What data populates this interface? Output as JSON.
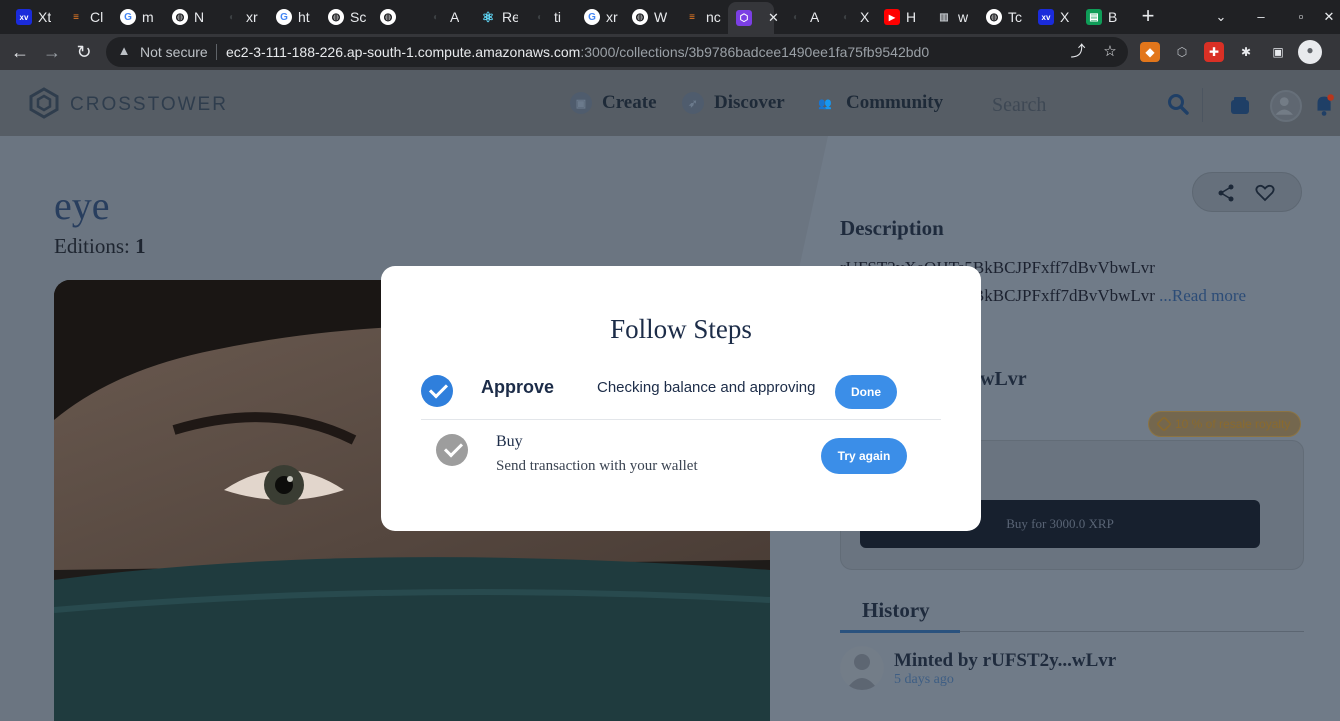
{
  "browser": {
    "tabs": [
      {
        "label": "Xt",
        "icon": "xaman-icon",
        "color": "#1a2bdb"
      },
      {
        "label": "Cl",
        "icon": "stackoverflow-icon",
        "color": "#f48024"
      },
      {
        "label": "m",
        "icon": "google-icon",
        "color": "#ffffff"
      },
      {
        "label": "N",
        "icon": "globe-icon",
        "color": "#ffffff"
      },
      {
        "label": "xr",
        "icon": "github-icon",
        "color": "#202124"
      },
      {
        "label": "ht",
        "icon": "google-icon",
        "color": "#ffffff"
      },
      {
        "label": "Sc",
        "icon": "globe-icon",
        "color": "#ffffff"
      },
      {
        "label": "",
        "icon": "globe-icon",
        "color": "#ffffff"
      },
      {
        "label": "A",
        "icon": "github-icon",
        "color": "#202124"
      },
      {
        "label": "Re",
        "icon": "react-icon",
        "color": "#61dafb"
      },
      {
        "label": "ti",
        "icon": "github-icon",
        "color": "#202124"
      },
      {
        "label": "xr",
        "icon": "google-icon",
        "color": "#ffffff"
      },
      {
        "label": "W",
        "icon": "globe-icon",
        "color": "#ffffff"
      },
      {
        "label": "nc",
        "icon": "stackoverflow-icon",
        "color": "#f48024"
      },
      {
        "label": "",
        "icon": "polygon-icon",
        "color": "#7b3fe4",
        "active": true
      },
      {
        "label": "A",
        "icon": "github-icon",
        "color": "#202124"
      },
      {
        "label": "X",
        "icon": "github-icon",
        "color": "#202124"
      },
      {
        "label": "H",
        "icon": "youtube-icon",
        "color": "#ff0000"
      },
      {
        "label": "w",
        "icon": "building-icon",
        "color": "#9aa0a6"
      },
      {
        "label": "Tc",
        "icon": "globe-icon",
        "color": "#ffffff"
      },
      {
        "label": "X",
        "icon": "xaman-icon",
        "color": "#1a2bdb"
      },
      {
        "label": "B",
        "icon": "sheets-icon",
        "color": "#0f9d58"
      }
    ],
    "address": {
      "security_label": "Not secure",
      "host": "ec2-3-111-188-226.ap-south-1.compute.amazonaws.com",
      "path": ":3000/collections/3b9786badcee1490ee1fa75fb9542bd0"
    }
  },
  "site": {
    "brand": "CROSSTOWER",
    "nav": [
      {
        "label": "Create",
        "icon": "create-icon"
      },
      {
        "label": "Discover",
        "icon": "compass-icon"
      },
      {
        "label": "Community",
        "icon": "community-icon"
      }
    ],
    "search_placeholder": "Search"
  },
  "nft": {
    "title": "eye",
    "editions_label": "Editions:",
    "editions_value": "1",
    "description_title": "Description",
    "description_line1": "rUFST2yXeQHTs5BkBCJPFxff7dBvVbwLvr",
    "description_line2": "rUFST2yXeQHTs5BkBCJPFxff7dBvVbwLvr",
    "read_more": "...Read more",
    "owner_fragment": "wLvr",
    "royalty": "10 % of resale royalty",
    "buy_label": "Buy for 3000.0 XRP",
    "history_title": "History",
    "history_entry": "Minted by rUFST2y...wLvr",
    "history_time": "5 days ago"
  },
  "modal": {
    "title": "Follow Steps",
    "steps": [
      {
        "name": "Approve",
        "description": "Checking balance and approving",
        "button": "Done",
        "status": "complete",
        "color": "#2f7fdc"
      },
      {
        "name": "Buy",
        "description": "Send transaction with your wallet",
        "button": "Try again",
        "status": "pending",
        "color": "#9d9d9d"
      }
    ]
  }
}
